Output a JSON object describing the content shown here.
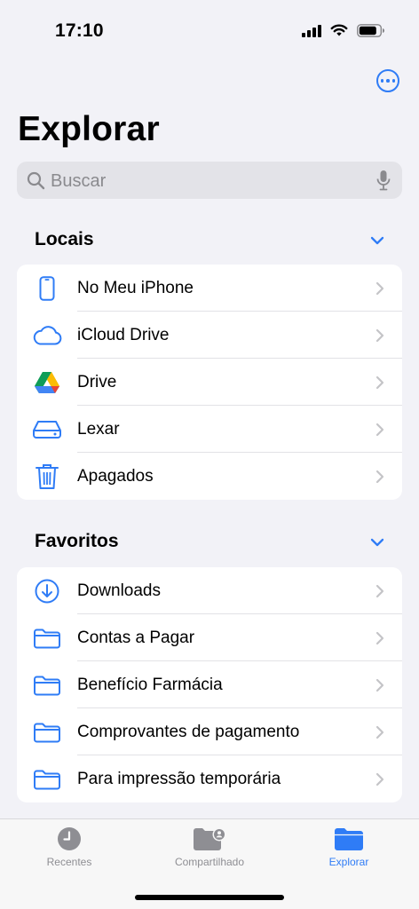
{
  "status_bar": {
    "time": "17:10"
  },
  "header": {
    "title": "Explorar",
    "more_icon": "ellipsis-circle-icon"
  },
  "search": {
    "placeholder": "Buscar"
  },
  "sections": {
    "locais": {
      "title": "Locais",
      "items": [
        {
          "label": "No Meu iPhone",
          "icon": "iphone-icon"
        },
        {
          "label": "iCloud Drive",
          "icon": "cloud-icon"
        },
        {
          "label": "Drive",
          "icon": "google-drive-icon"
        },
        {
          "label": "Lexar",
          "icon": "external-drive-icon"
        },
        {
          "label": "Apagados",
          "icon": "trash-icon"
        }
      ]
    },
    "favoritos": {
      "title": "Favoritos",
      "items": [
        {
          "label": "Downloads",
          "icon": "download-circle-icon"
        },
        {
          "label": "Contas a Pagar",
          "icon": "folder-icon"
        },
        {
          "label": "Benefício Farmácia",
          "icon": "folder-icon"
        },
        {
          "label": "Comprovantes de pagamento",
          "icon": "folder-icon"
        },
        {
          "label": "Para impressão temporária",
          "icon": "folder-icon"
        }
      ]
    }
  },
  "tab_bar": {
    "tabs": [
      {
        "label": "Recentes",
        "icon": "clock-icon",
        "active": false
      },
      {
        "label": "Compartilhado",
        "icon": "shared-folder-icon",
        "active": false
      },
      {
        "label": "Explorar",
        "icon": "folder-fill-icon",
        "active": true
      }
    ]
  },
  "colors": {
    "accent": "#2f7cf6",
    "background": "#f2f2f7",
    "inactive": "#8e8e93"
  }
}
